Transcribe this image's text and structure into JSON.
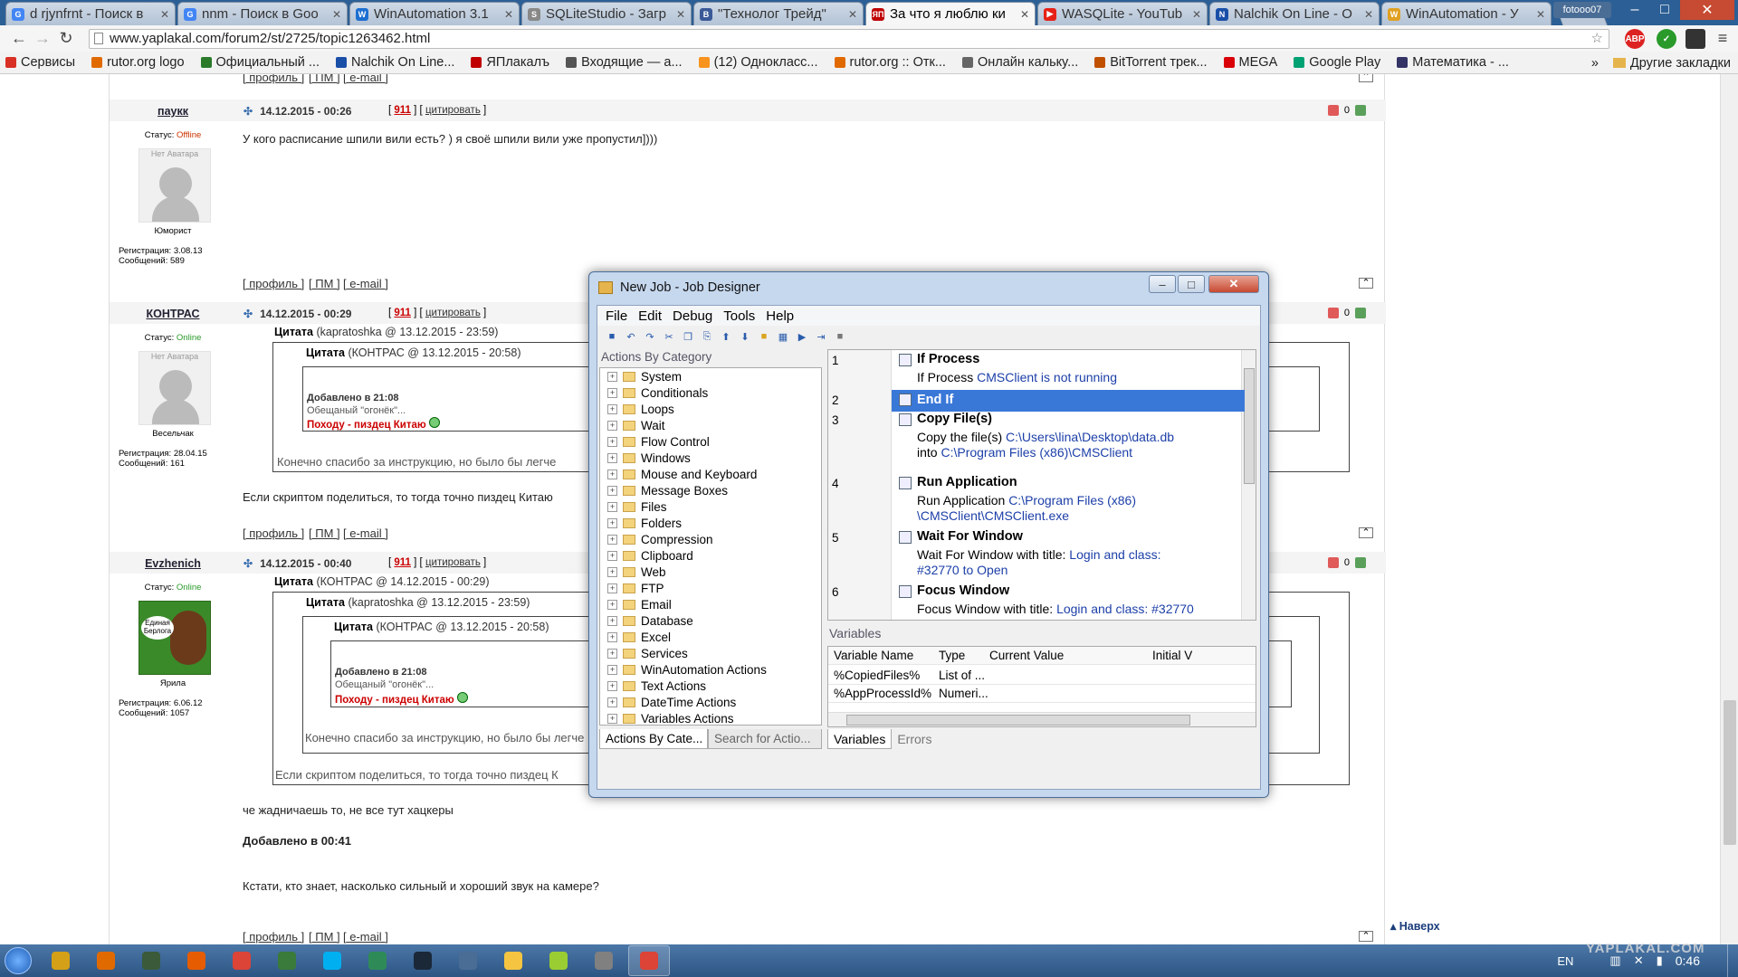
{
  "browser": {
    "tabs": [
      {
        "title": "d rjynfrnt - Поиск в",
        "color": "#4285f4",
        "glyph": "G"
      },
      {
        "title": "nnm - Поиск в Goo",
        "color": "#4285f4",
        "glyph": "G"
      },
      {
        "title": "WinAutomation 3.1",
        "color": "#1d6fd0",
        "glyph": "W"
      },
      {
        "title": "SQLiteStudio - Загр",
        "color": "#888888",
        "glyph": "S"
      },
      {
        "title": "\"Технолог Трейд\"",
        "color": "#3b5998",
        "glyph": "В"
      },
      {
        "title": "За что я люблю ки",
        "color": "#c00000",
        "glyph": "ЯП"
      },
      {
        "title": "WASQLite - YouTub",
        "color": "#e62117",
        "glyph": "▶"
      },
      {
        "title": "Nalchik On Line - О",
        "color": "#1a4fa8",
        "glyph": "N"
      },
      {
        "title": "WinAutomation - У",
        "color": "#e0a020",
        "glyph": "W"
      }
    ],
    "active_tab": 5,
    "profile_name": "fotooo07",
    "url": "www.yaplakal.com/forum2/st/2725/topic1263462.html",
    "extensions": [
      "ABP",
      "✓"
    ],
    "bookmarks": [
      {
        "label": "Сервисы",
        "color": "#d93025"
      },
      {
        "label": "rutor.org logo",
        "color": "#e06a00"
      },
      {
        "label": "Официальный ...",
        "color": "#2a7a2a"
      },
      {
        "label": "Nalchik On Line...",
        "color": "#1a4fa8"
      },
      {
        "label": "ЯПлакалъ",
        "color": "#c00000"
      },
      {
        "label": "Входящие — а...",
        "color": "#555555"
      },
      {
        "label": "(12) Однокласс...",
        "color": "#f7931e"
      },
      {
        "label": "rutor.org :: Отк...",
        "color": "#e06a00"
      },
      {
        "label": "Онлайн калькy...",
        "color": "#666666"
      },
      {
        "label": "BitTorrent трек...",
        "color": "#c05000"
      },
      {
        "label": "MEGA",
        "color": "#d90007"
      },
      {
        "label": "Google Play",
        "color": "#00a173"
      },
      {
        "label": "Математика - ...",
        "color": "#333366"
      }
    ],
    "bookmarks_more": "»",
    "other_bookmarks": "Другие закладки"
  },
  "forum": {
    "footer_links": [
      "[ профиль ]",
      "[ ПМ ]",
      "[ e-mail ]"
    ],
    "posts": [
      {
        "user": "паукк",
        "status_label": "Статус:",
        "status": "Offline",
        "status_color": "#cc3300",
        "avatar_text": "Нет Аватара",
        "title": "Юморист",
        "reg": "Регистрация: 3.08.13",
        "msgs": "Сообщений: 589",
        "date": "14.12.2015 - 00:26",
        "rating": "911",
        "cite": "цитировать",
        "score": "0",
        "text": "У кого расписание шпили вили есть? ) я своё шпили вили уже пропустил])))"
      },
      {
        "user": "КОНТРАС",
        "status_label": "Статус:",
        "status": "Online",
        "status_color": "#2a9a2a",
        "avatar_text": "Нет Аватара",
        "title": "Весельчак",
        "reg": "Регистрация: 28.04.15",
        "msgs": "Сообщений: 161",
        "date": "14.12.2015 - 00:29",
        "rating": "911",
        "cite": "цитировать",
        "score": "0",
        "q1": "Цитата",
        "q1_src": "(kapratoshka @ 13.12.2015 - 23:59)",
        "q2": "Цитата",
        "q2_src": "(КОНТРАС @ 13.12.2015 - 20:58)",
        "added": "Добавлено в 21:08",
        "promised": "Обещаный \"огонёк\"...",
        "redline": "Походу - пиздец Китаю",
        "qtext": "Конечно спасибо за инструкцию, но было бы легче",
        "text": "Если скриптом поделиться, то тогда точно пиздец Китаю"
      },
      {
        "user": "Evzhenich",
        "status_label": "Статус:",
        "status": "Online",
        "status_color": "#2a9a2a",
        "avatar_caption": "Единая Берлога",
        "title": "Ярила",
        "reg": "Регистрация: 6.06.12",
        "msgs": "Сообщений: 1057",
        "date": "14.12.2015 - 00:40",
        "rating": "911",
        "cite": "цитировать",
        "score": "0",
        "q1": "Цитата",
        "q1_src": "(КОНТРАС @ 14.12.2015 - 00:29)",
        "q2": "Цитата",
        "q2_src": "(kapratoshka @ 13.12.2015 - 23:59)",
        "q3": "Цитата",
        "q3_src": "(КОНТРАС @ 13.12.2015 - 20:58)",
        "added": "Добавлено в 21:08",
        "promised": "Обещаный \"огонёк\"...",
        "redline": "Походу - пиздец Китаю",
        "qtext2": "Конечно спасибо за инструкцию, но было бы легче",
        "qtext1": "Если скриптом поделиться, то тогда точно пиздец К",
        "text1": "че жадничаешь то, не все тут хацкеры",
        "added2": "Добавлено в 00:41",
        "text2": "Кстати, кто знает, насколько сильный и хороший звук на камере?"
      }
    ],
    "back_to_top": "Наверх"
  },
  "dialog": {
    "title": "New Job - Job Designer",
    "menu": [
      "File",
      "Edit",
      "Debug",
      "Tools",
      "Help"
    ],
    "left_title": "Actions By Category",
    "categories": [
      "System",
      "Conditionals",
      "Loops",
      "Wait",
      "Flow Control",
      "Windows",
      "Mouse and Keyboard",
      "Message Boxes",
      "Files",
      "Folders",
      "Compression",
      "Clipboard",
      "Web",
      "FTP",
      "Email",
      "Database",
      "Excel",
      "Services",
      "WinAutomation Actions",
      "Text Actions",
      "DateTime Actions",
      "Variables Actions"
    ],
    "left_tabs": [
      "Actions By Cate...",
      "Search for Actio..."
    ],
    "actions": [
      {
        "n": "1",
        "name": "If Process",
        "d1": "If Process ",
        "d1v": "CMSClient is not running",
        "d2": "",
        "d2v": ""
      },
      {
        "n": "2",
        "name": "End If",
        "d1": "",
        "d1v": "",
        "d2": "",
        "d2v": ""
      },
      {
        "n": "3",
        "name": "Copy File(s)",
        "d1": "Copy the file(s) ",
        "d1v": "C:\\Users\\lina\\Desktop\\data.db",
        "d2": "into ",
        "d2v": "C:\\Program Files (x86)\\CMSClient"
      },
      {
        "n": "4",
        "name": "Run Application",
        "d1": "Run Application ",
        "d1v": "C:\\Program Files (x86)",
        "d2": "",
        "d2v": "\\CMSClient\\CMSClient.exe"
      },
      {
        "n": "5",
        "name": "Wait For Window",
        "d1": "Wait For Window with title: ",
        "d1v": "Login and class:",
        "d2": "",
        "d2v": "#32770 to Open"
      },
      {
        "n": "6",
        "name": "Focus Window",
        "d1": "Focus Window with title: ",
        "d1v": "Login and class: #32770",
        "d2": "",
        "d2v": ""
      }
    ],
    "selected_action": 1,
    "vars_title": "Variables",
    "var_cols": [
      "Variable Name",
      "Type",
      "Current Value",
      "Initial V"
    ],
    "vars": [
      {
        "name": "%CopiedFiles%",
        "type": "List of ...",
        "value": ""
      },
      {
        "name": "%AppProcessId%",
        "type": "Numeri...",
        "value": ""
      }
    ],
    "right_tabs": [
      "Variables",
      "Errors"
    ]
  },
  "taskbar": {
    "apps": [
      "#d4a017",
      "#e06a00",
      "#3a5a3a",
      "#e65c00",
      "#db4437",
      "#3a7a3a",
      "#00aff0",
      "#2e8b57",
      "#1b2838",
      "#4a6d96",
      "#f5c542",
      "#9acd32",
      "#808080",
      "#db4437"
    ],
    "active": [
      13
    ],
    "lang": "EN",
    "time": "0:46",
    "watermark": "YAPLAKAL.COM"
  }
}
